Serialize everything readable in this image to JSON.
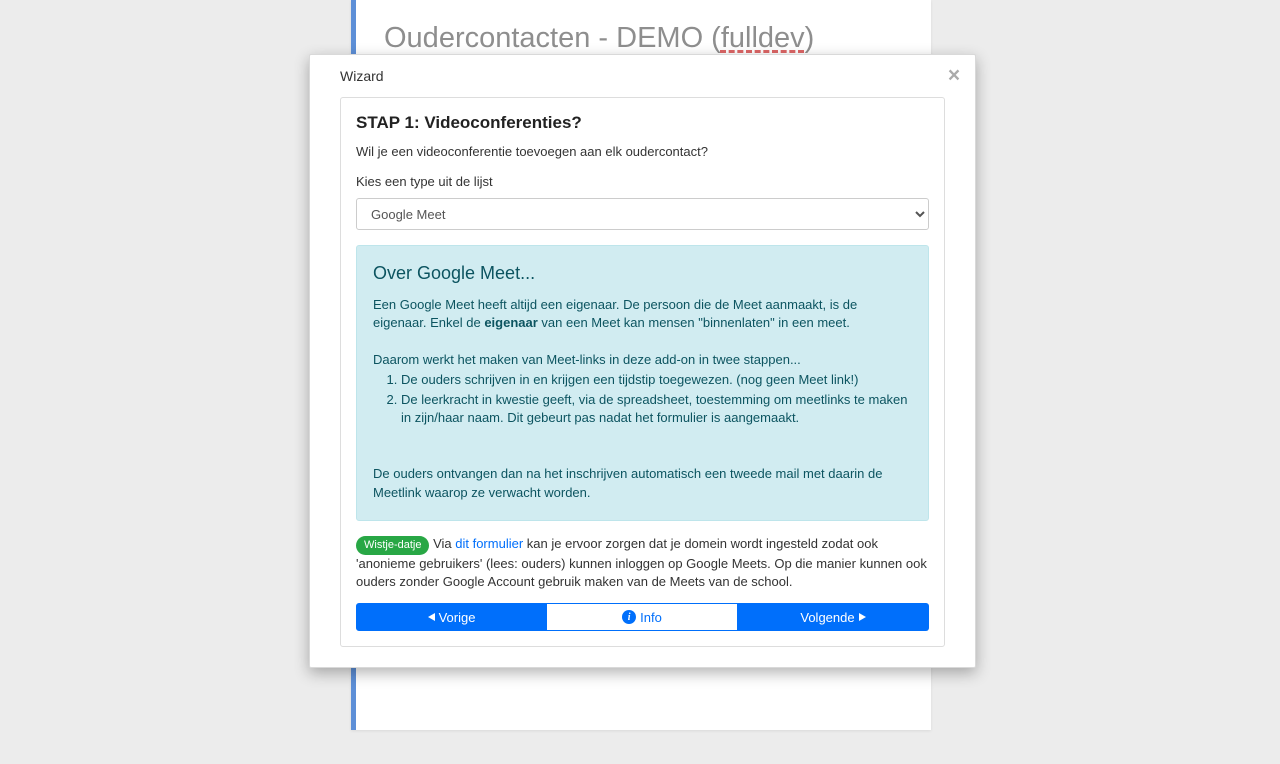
{
  "background": {
    "title_prefix": "Oudercontacten - DEMO (",
    "title_link": "fulldev",
    "title_suffix": ")"
  },
  "modal": {
    "header": "Wizard"
  },
  "step": {
    "title": "STAP 1: Videoconferenties?",
    "question": "Wil je een videoconferentie toevoegen aan elk oudercontact?",
    "select_label": "Kies een type uit de lijst",
    "select_value": "Google Meet"
  },
  "info": {
    "title": "Over Google Meet...",
    "p1a": "Een Google Meet heeft altijd een eigenaar. De persoon die de Meet aanmaakt, is de eigenaar. Enkel de ",
    "p1b_bold": "eigenaar",
    "p1c": " van een Meet kan mensen \"binnenlaten\" in een meet.",
    "p2": "Daarom werkt het maken van Meet-links in deze add-on in twee stappen...",
    "li1": "De ouders schrijven in en krijgen een tijdstip toegewezen. (nog geen Meet link!)",
    "li2": "De leerkracht in kwestie geeft, via de spreadsheet, toestemming om meetlinks te maken in zijn/haar naam. Dit gebeurt pas nadat het formulier is aangemaakt.",
    "p3": "De ouders ontvangen dan na het inschrijven automatisch een tweede mail met daarin de Meetlink waarop ze verwacht worden."
  },
  "tip": {
    "badge": "Wistje-datje",
    "t1": " Via ",
    "link": "dit formulier",
    "t2": " kan je ervoor zorgen dat je domein wordt ingesteld zodat ook 'anonieme gebruikers' (lees: ouders) kunnen inloggen op Google Meets. Op die manier kunnen ook ouders zonder Google Account gebruik maken van de Meets van de school."
  },
  "buttons": {
    "prev": "Vorige",
    "info": "Info",
    "next": "Volgende"
  }
}
